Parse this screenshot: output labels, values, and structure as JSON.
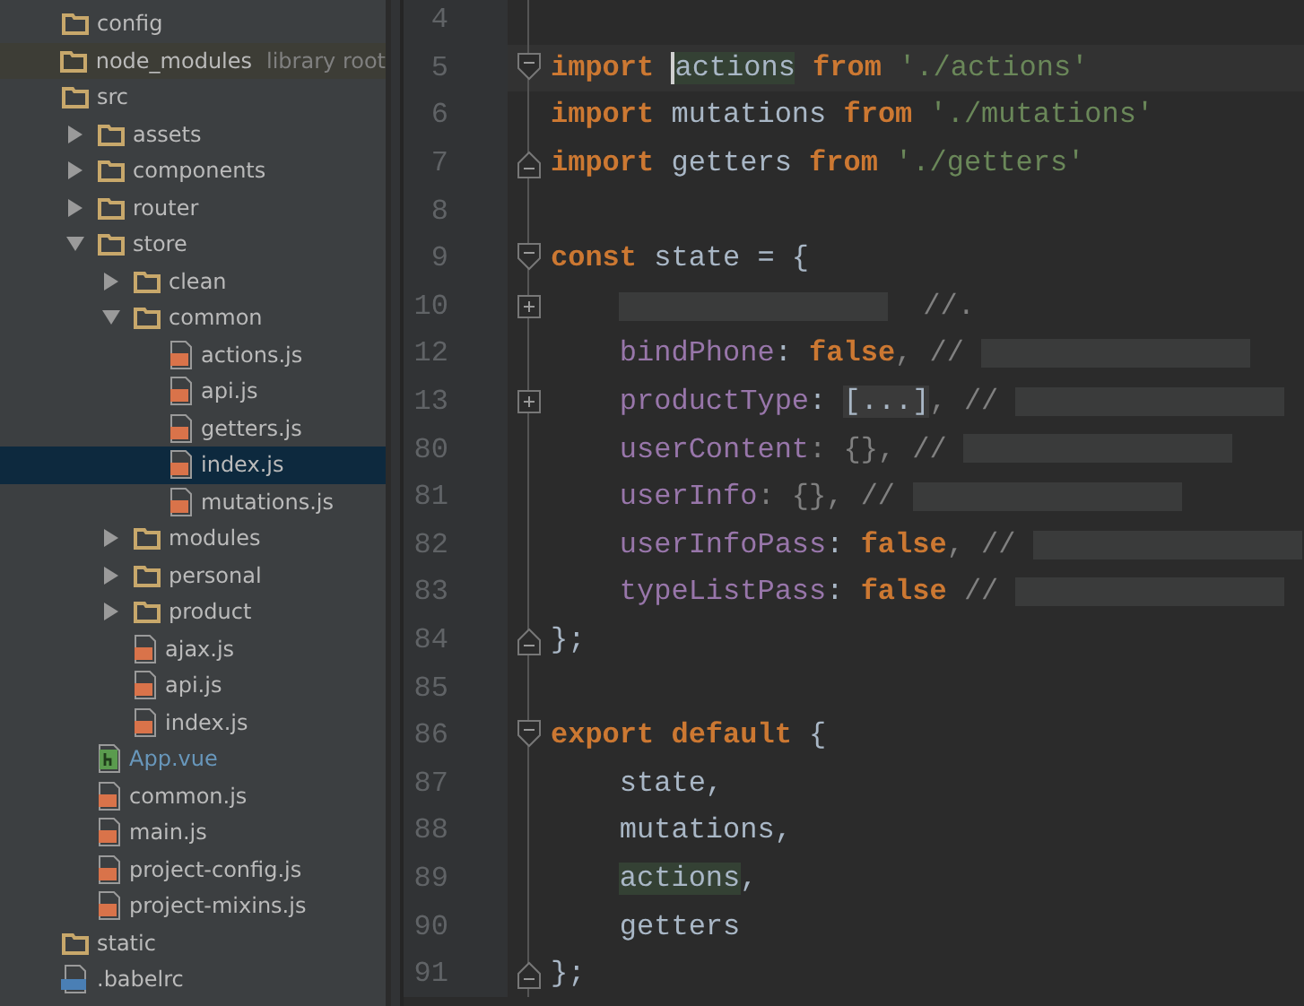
{
  "project_tree": {
    "items": [
      {
        "name": "config",
        "kind": "folder"
      },
      {
        "name": "node_modules",
        "kind": "folder",
        "library": true,
        "hint": "library root"
      },
      {
        "name": "src",
        "kind": "folder",
        "children": [
          {
            "name": "assets",
            "kind": "folder",
            "expanded": false
          },
          {
            "name": "components",
            "kind": "folder",
            "expanded": false
          },
          {
            "name": "router",
            "kind": "folder",
            "expanded": false
          },
          {
            "name": "store",
            "kind": "folder",
            "expanded": true,
            "children": [
              {
                "name": "clean",
                "kind": "folder",
                "expanded": false
              },
              {
                "name": "common",
                "kind": "folder",
                "expanded": true,
                "children": [
                  {
                    "name": "actions.js",
                    "kind": "js",
                    "selected": false
                  },
                  {
                    "name": "api.js",
                    "kind": "js",
                    "selected": false
                  },
                  {
                    "name": "getters.js",
                    "kind": "js",
                    "selected": false
                  },
                  {
                    "name": "index.js",
                    "kind": "js",
                    "selected": true
                  },
                  {
                    "name": "mutations.js",
                    "kind": "js",
                    "selected": false
                  }
                ]
              },
              {
                "name": "modules",
                "kind": "folder",
                "expanded": false
              },
              {
                "name": "personal",
                "kind": "folder",
                "expanded": false
              },
              {
                "name": "product",
                "kind": "folder",
                "expanded": false
              },
              {
                "name": "ajax.js",
                "kind": "js",
                "selected": false
              },
              {
                "name": "api.js",
                "kind": "js",
                "selected": false
              },
              {
                "name": "index.js",
                "kind": "js",
                "selected": false
              }
            ]
          },
          {
            "name": "App.vue",
            "kind": "vue",
            "modified": true,
            "selected": false
          },
          {
            "name": "common.js",
            "kind": "js",
            "selected": false
          },
          {
            "name": "main.js",
            "kind": "js",
            "selected": false
          },
          {
            "name": "project-config.js",
            "kind": "js",
            "selected": false
          },
          {
            "name": "project-mixins.js",
            "kind": "js",
            "selected": false
          }
        ]
      },
      {
        "name": "static",
        "kind": "folder"
      },
      {
        "name": ".babelrc",
        "kind": "json"
      }
    ]
  },
  "editor": {
    "lines": [
      {
        "number": "4",
        "kind": "plain"
      },
      {
        "number": "5",
        "kind": "opener",
        "current": true,
        "tokens": [
          {
            "text": "import ",
            "kind": "keyword"
          },
          {
            "text": "actions",
            "kind": "plain",
            "highlight": true,
            "caret": true
          },
          {
            "text": " from",
            "kind": "keyword"
          },
          {
            "text": " './actions'",
            "kind": "string"
          }
        ]
      },
      {
        "number": "6",
        "kind": "plain",
        "tokens": [
          {
            "text": "import",
            "kind": "keyword"
          },
          {
            "text": " mutations ",
            "kind": "plain"
          },
          {
            "text": "from",
            "kind": "keyword"
          },
          {
            "text": " './mutations'",
            "kind": "string"
          }
        ]
      },
      {
        "number": "7",
        "kind": "closer",
        "tokens": [
          {
            "text": "import",
            "kind": "keyword"
          },
          {
            "text": " getters ",
            "kind": "plain"
          },
          {
            "text": "from",
            "kind": "keyword"
          },
          {
            "text": " './getters'",
            "kind": "string"
          }
        ]
      },
      {
        "number": "8",
        "kind": "plain"
      },
      {
        "number": "9",
        "kind": "opener",
        "tokens": [
          {
            "text": "const",
            "kind": "keyword"
          },
          {
            "text": " state = {",
            "kind": "plain"
          }
        ]
      },
      {
        "number": "10",
        "kind": "collapsed",
        "indent": true,
        "tokens": [
          {
            "kind": "redacted"
          },
          {
            "text": "  //.",
            "kind": "comment"
          }
        ]
      },
      {
        "number": "12",
        "kind": "plain",
        "indent": true,
        "tokens": [
          {
            "text": "bindPhone",
            "kind": "property"
          },
          {
            "text": ": ",
            "kind": "plain"
          },
          {
            "text": "false",
            "kind": "keyword"
          },
          {
            "text": ", // ",
            "kind": "comment"
          },
          {
            "kind": "redacted"
          }
        ]
      },
      {
        "number": "13",
        "kind": "collapsed",
        "indent": true,
        "tokens": [
          {
            "text": "productType",
            "kind": "property"
          },
          {
            "text": ": ",
            "kind": "plain"
          },
          {
            "text": "[...]",
            "kind": "folded"
          },
          {
            "text": ", // ",
            "kind": "comment"
          },
          {
            "kind": "redacted"
          }
        ]
      },
      {
        "number": "80",
        "kind": "plain",
        "indent": true,
        "tokens": [
          {
            "text": "userContent",
            "kind": "property"
          },
          {
            "text": ": {}, // ",
            "kind": "comment"
          },
          {
            "kind": "redacted"
          }
        ]
      },
      {
        "number": "81",
        "kind": "plain",
        "indent": true,
        "tokens": [
          {
            "text": "userInfo",
            "kind": "property"
          },
          {
            "text": ": {}, // ",
            "kind": "comment"
          },
          {
            "kind": "redacted"
          }
        ]
      },
      {
        "number": "82",
        "kind": "plain",
        "indent": true,
        "tokens": [
          {
            "text": "userInfoPass",
            "kind": "property"
          },
          {
            "text": ": ",
            "kind": "plain"
          },
          {
            "text": "false",
            "kind": "keyword"
          },
          {
            "text": ", // ",
            "kind": "comment"
          },
          {
            "kind": "redacted"
          }
        ]
      },
      {
        "number": "83",
        "kind": "plain",
        "indent": true,
        "tokens": [
          {
            "text": "typeListPass",
            "kind": "property"
          },
          {
            "text": ": ",
            "kind": "plain"
          },
          {
            "text": "false",
            "kind": "keyword"
          },
          {
            "text": " // ",
            "kind": "comment"
          },
          {
            "kind": "redacted"
          }
        ]
      },
      {
        "number": "84",
        "kind": "closer",
        "tokens": [
          {
            "text": "};",
            "kind": "plain"
          }
        ]
      },
      {
        "number": "85",
        "kind": "plain"
      },
      {
        "number": "86",
        "kind": "opener",
        "tokens": [
          {
            "text": "export default",
            "kind": "keyword"
          },
          {
            "text": " {",
            "kind": "plain"
          }
        ]
      },
      {
        "number": "87",
        "kind": "plain",
        "indent": true,
        "tokens": [
          {
            "text": "state,",
            "kind": "plain"
          }
        ]
      },
      {
        "number": "88",
        "kind": "plain",
        "indent": true,
        "tokens": [
          {
            "text": "mutations,",
            "kind": "plain"
          }
        ]
      },
      {
        "number": "89",
        "kind": "plain",
        "indent": true,
        "tokens": [
          {
            "text": "actions",
            "kind": "plain",
            "highlight": true
          },
          {
            "text": ",",
            "kind": "plain"
          }
        ]
      },
      {
        "number": "90",
        "kind": "plain",
        "indent": true,
        "tokens": [
          {
            "text": "getters",
            "kind": "plain"
          }
        ]
      },
      {
        "number": "91",
        "kind": "closer",
        "tokens": [
          {
            "text": "};",
            "kind": "plain"
          }
        ]
      }
    ]
  }
}
